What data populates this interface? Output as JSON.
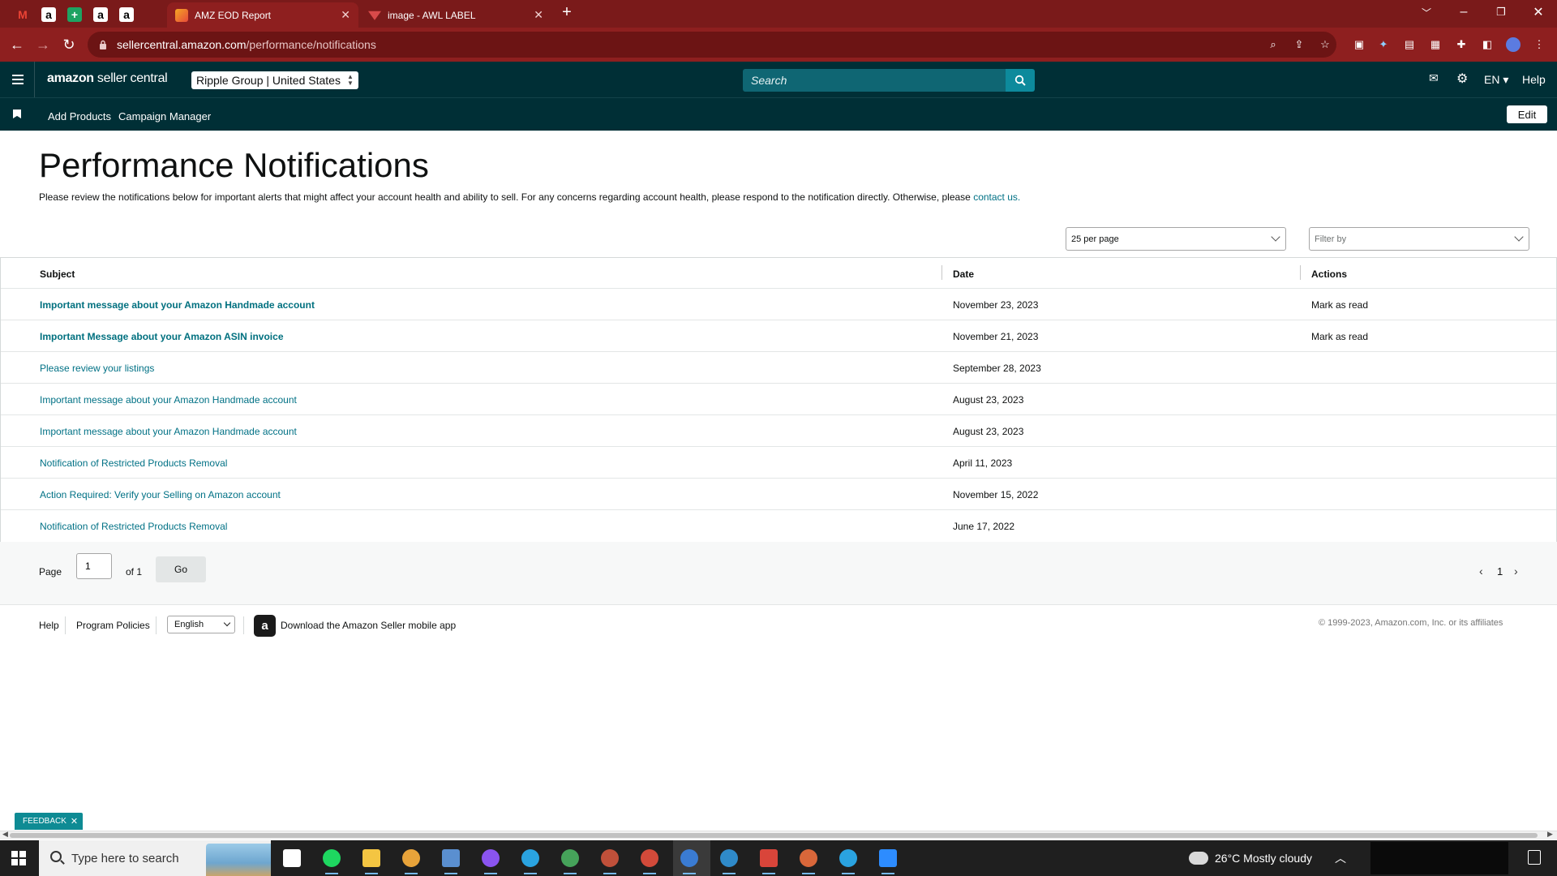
{
  "browser": {
    "pinned_tabs": [
      {
        "icon": "gmail-icon",
        "glyph": "M",
        "color": "#ea4335",
        "bg": "transparent"
      },
      {
        "icon": "amazon-icon",
        "glyph": "a",
        "color": "#000000",
        "bg": "#ffffff"
      },
      {
        "icon": "sheets-icon",
        "glyph": "+",
        "color": "#ffffff",
        "bg": "#1ea362"
      },
      {
        "icon": "amazon-icon",
        "glyph": "a",
        "color": "#000000",
        "bg": "#ffffff"
      },
      {
        "icon": "amazon-icon",
        "glyph": "a",
        "color": "#000000",
        "bg": "#ffffff"
      }
    ],
    "tabs": [
      {
        "title": "AMZ EOD Report",
        "active": true
      },
      {
        "title": "image - AWL LABEL",
        "active": false
      }
    ],
    "url_host": "sellercentral.amazon.com",
    "url_path": "/performance/notifications"
  },
  "header": {
    "logo_bold": "amazon",
    "logo_rest": " seller central",
    "account": "Ripple Group | United States",
    "search_placeholder": "Search",
    "language": "EN ▾",
    "help": "Help"
  },
  "bookmarks": {
    "items": [
      "Add Products",
      "Campaign Manager"
    ],
    "edit_label": "Edit"
  },
  "page": {
    "title": "Performance Notifications",
    "intro": "Please review the notifications below for important alerts that might affect your account health and ability to sell. For any concerns regarding account health, please respond to the notification directly. Otherwise, please ",
    "intro_link": "contact us.",
    "per_page": "25 per page",
    "filter_placeholder": "Filter by"
  },
  "table": {
    "columns": [
      "Subject",
      "Date",
      "Actions"
    ],
    "rows": [
      {
        "subject": "Important message about your Amazon Handmade account",
        "date": "November 23, 2023",
        "action": "Mark as read",
        "unread": true
      },
      {
        "subject": "Important Message about your Amazon ASIN invoice",
        "date": "November 21, 2023",
        "action": "Mark as read",
        "unread": true
      },
      {
        "subject": "Please review your listings",
        "date": "September 28, 2023",
        "action": "",
        "unread": false
      },
      {
        "subject": "Important message about your Amazon Handmade account",
        "date": "August 23, 2023",
        "action": "",
        "unread": false
      },
      {
        "subject": "Important message about your Amazon Handmade account",
        "date": "August 23, 2023",
        "action": "",
        "unread": false
      },
      {
        "subject": "Notification of Restricted Products Removal",
        "date": "April 11, 2023",
        "action": "",
        "unread": false
      },
      {
        "subject": "Action Required: Verify your Selling on Amazon account",
        "date": "November 15, 2022",
        "action": "",
        "unread": false
      },
      {
        "subject": "Notification of Restricted Products Removal",
        "date": "June 17, 2022",
        "action": "",
        "unread": false
      }
    ]
  },
  "pagination": {
    "page_label": "Page",
    "page_value": "1",
    "of_label": "of 1",
    "go_label": "Go",
    "current": "1"
  },
  "footer": {
    "help": "Help",
    "policies": "Program Policies",
    "language": "English",
    "app_text": "Download the Amazon Seller mobile app",
    "copyright": "© 1999-2023, Amazon.com, Inc. or its affiliates"
  },
  "feedback": "FEEDBACK",
  "taskbar": {
    "search_placeholder": "Type here to search",
    "weather": "26°C  Mostly cloudy",
    "apps": [
      {
        "name": "task-view-icon",
        "color": "#ffffff",
        "shape": "sq"
      },
      {
        "name": "spotify-icon",
        "color": "#1ed760",
        "shape": "circ"
      },
      {
        "name": "file-explorer-icon",
        "color": "#f4c542",
        "shape": "sq"
      },
      {
        "name": "chrome-icon",
        "color": "#e8a33a",
        "shape": "circ"
      },
      {
        "name": "calculator-icon",
        "color": "#5a8fd0",
        "shape": "sq"
      },
      {
        "name": "messenger-icon",
        "color": "#8a54f0",
        "shape": "circ"
      },
      {
        "name": "telegram-icon",
        "color": "#2aa3e0",
        "shape": "circ"
      },
      {
        "name": "chrome-profile-icon",
        "color": "#46a35a",
        "shape": "circ"
      },
      {
        "name": "chrome-profile-icon",
        "color": "#c0503a",
        "shape": "circ"
      },
      {
        "name": "chrome-profile-icon",
        "color": "#d24a3a",
        "shape": "circ"
      },
      {
        "name": "chrome-profile-icon",
        "color": "#3a7bd2",
        "shape": "circ"
      },
      {
        "name": "chrome-profile-icon",
        "color": "#2f8ac9",
        "shape": "circ"
      },
      {
        "name": "app-icon",
        "color": "#d9453a",
        "shape": "sq"
      },
      {
        "name": "chrome-profile-icon",
        "color": "#d9673a",
        "shape": "circ"
      },
      {
        "name": "telegram-icon",
        "color": "#2aa3e0",
        "shape": "circ"
      },
      {
        "name": "zoom-icon",
        "color": "#2d8cff",
        "shape": "sq"
      }
    ]
  }
}
